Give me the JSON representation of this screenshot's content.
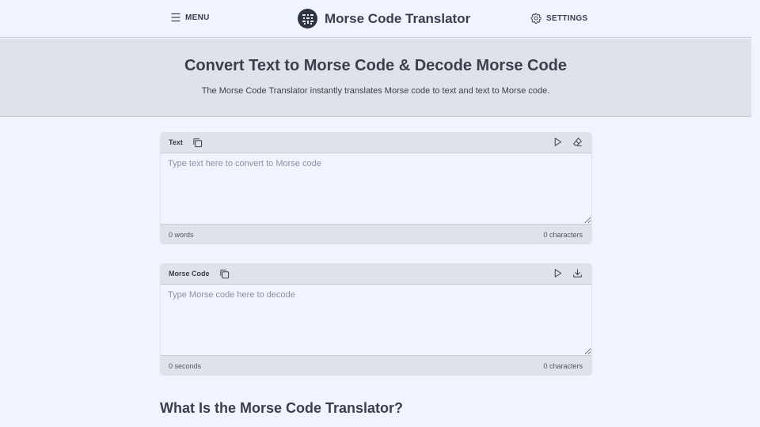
{
  "header": {
    "menu_label": "MENU",
    "site_title": "Morse Code Translator",
    "settings_label": "SETTINGS"
  },
  "hero": {
    "heading": "Convert Text to Morse Code & Decode Morse Code",
    "subtitle": "The Morse Code Translator instantly translates Morse code to text and text to Morse code."
  },
  "text_panel": {
    "label": "Text",
    "value": "",
    "placeholder": "Type text here to convert to Morse code",
    "word_count": "0 words",
    "char_count": "0 characters"
  },
  "morse_panel": {
    "label": "Morse Code",
    "value": "",
    "placeholder": "Type Morse code here to decode",
    "duration": "0 seconds",
    "char_count": "0 characters"
  },
  "main": {
    "section_heading": "What Is the Morse Code Translator?"
  },
  "icons": {
    "menu": "hamburger-icon",
    "logo": "morse-logo-icon",
    "settings": "gear-icon",
    "copy": "copy-icon",
    "play": "play-icon",
    "clear": "eraser-icon",
    "download": "download-icon"
  },
  "colors": {
    "background": "#f0f4fe",
    "panel": "#dfe2e9",
    "text": "#3a3f4b",
    "logo_bg": "#2e3442"
  }
}
